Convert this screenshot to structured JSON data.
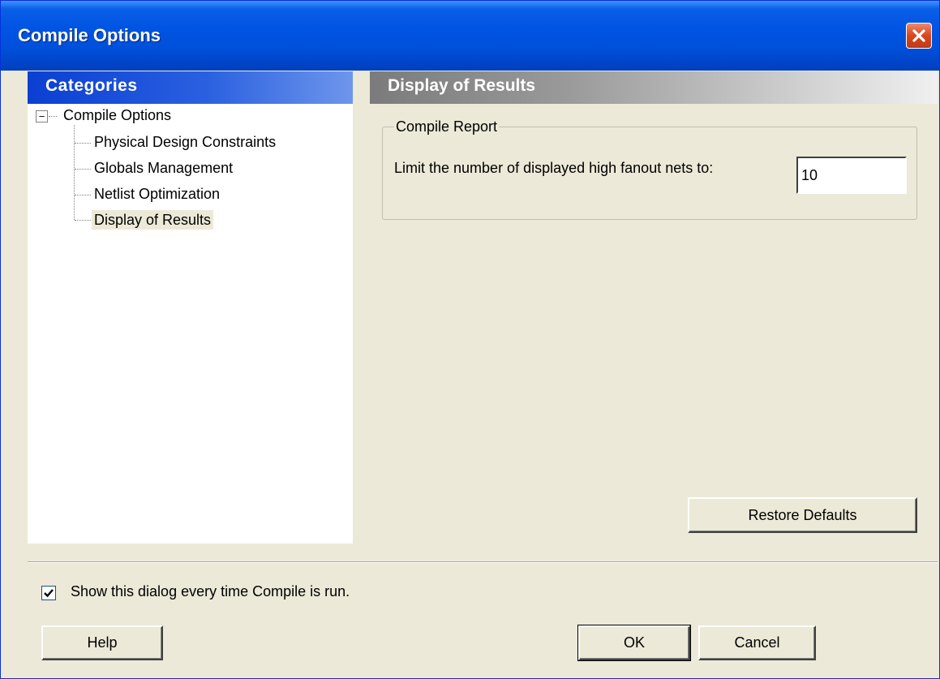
{
  "window": {
    "title": "Compile Options",
    "close_glyph": "✕"
  },
  "categories": {
    "header": "Categories",
    "root": {
      "expander": "−",
      "label": "Compile Options"
    },
    "items": [
      {
        "label": "Physical Design Constraints",
        "selected": false
      },
      {
        "label": "Globals Management",
        "selected": false
      },
      {
        "label": "Netlist Optimization",
        "selected": false
      },
      {
        "label": "Display of Results",
        "selected": true
      }
    ]
  },
  "results": {
    "header": "Display of Results",
    "group_title": "Compile Report",
    "limit_label": "Limit the number of displayed high fanout nets to:",
    "limit_value": "10",
    "restore_defaults_label": "Restore Defaults"
  },
  "footer": {
    "show_dialog_checked": true,
    "show_dialog_label": "Show this dialog every time Compile is run.",
    "help_label": "Help",
    "ok_label": "OK",
    "cancel_label": "Cancel"
  },
  "colors": {
    "title_bar": "#0054E3",
    "categories_header": "#0A3FD2",
    "results_header": "#7B7B7B",
    "dialog_background": "#ECE9D8",
    "close_button": "#D6471E"
  },
  "icons": {
    "close": "close-icon",
    "tree_expander": "minus-icon",
    "checkbox": "checkmark-icon"
  }
}
